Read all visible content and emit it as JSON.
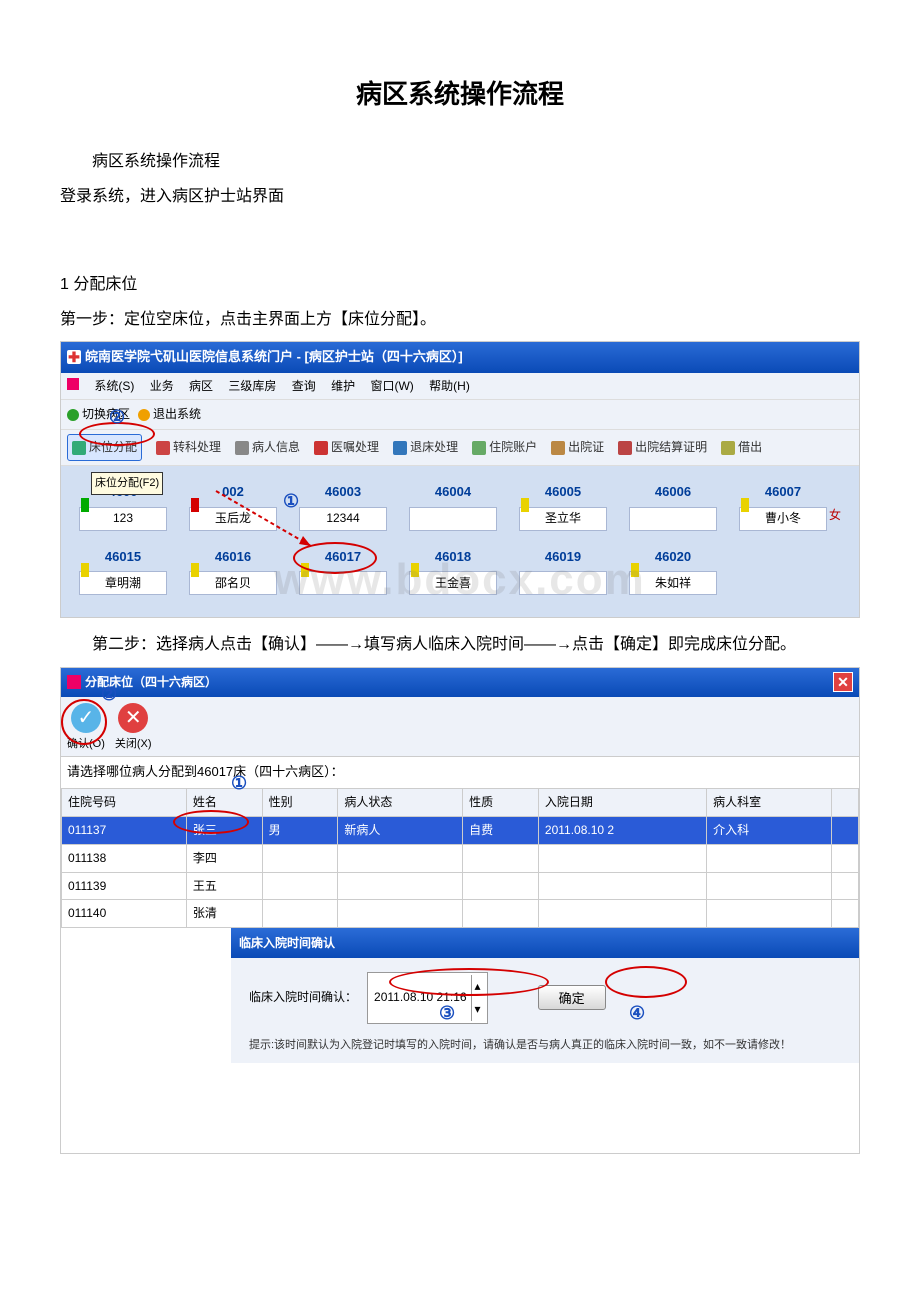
{
  "doc": {
    "title": "病区系统操作流程",
    "p1": "病区系统操作流程",
    "p2": "登录系统，进入病区护士站界面",
    "p3": "1 分配床位",
    "p4": "第一步：定位空床位，点击主界面上方【床位分配】。",
    "p5": "第二步：选择病人点击【确认】——→填写病人临床入院时间——→点击【确定】即完成床位分配。"
  },
  "s1": {
    "title": "皖南医学院弋矶山医院信息系统门户 - [病区护士站（四十六病区）]",
    "menu": {
      "sys": "系统(S)",
      "biz": "业务",
      "ward": "病区",
      "stock": "三级库房",
      "query": "查询",
      "maint": "维护",
      "win": "窗口(W)",
      "help": "帮助(H)"
    },
    "tool1": {
      "switch": "切换病区",
      "exit": "退出系统"
    },
    "tool2": {
      "bed": "床位分配",
      "trans": "转科处理",
      "info": "病人信息",
      "order": "医嘱处理",
      "leave": "退床处理",
      "acct": "住院账户",
      "cert": "出院证",
      "billcert": "出院结算证明",
      "borrow": "借出"
    },
    "tooltip": "床位分配(F2)",
    "beds_r1": [
      {
        "num": "4600",
        "name": "123",
        "tag": "green"
      },
      {
        "num": "002",
        "name": "玉后龙",
        "tag": "red"
      },
      {
        "num": "46003",
        "name": "12344",
        "tag": ""
      },
      {
        "num": "46004",
        "name": "",
        "tag": ""
      },
      {
        "num": "46005",
        "name": "圣立华",
        "tag": "yellow"
      },
      {
        "num": "46006",
        "name": "",
        "tag": ""
      },
      {
        "num": "46007",
        "name": "曹小冬",
        "gender": "女",
        "tag": "yellow"
      }
    ],
    "beds_r2": [
      {
        "num": "46015",
        "name": "章明潮",
        "tag": "yellow"
      },
      {
        "num": "46016",
        "name": "邵名贝",
        "tag": "yellow"
      },
      {
        "num": "46017",
        "name": "",
        "tag": "yellow"
      },
      {
        "num": "46018",
        "name": "王金喜",
        "tag": "yellow"
      },
      {
        "num": "46019",
        "name": "",
        "tag": ""
      },
      {
        "num": "46020",
        "name": "朱如祥",
        "tag": "yellow"
      }
    ]
  },
  "s2": {
    "title": "分配床位（四十六病区）",
    "ok": "确认(O)",
    "close": "关闭(X)",
    "prompt": "请选择哪位病人分配到46017床（四十六病区）：",
    "cols": {
      "id": "住院号码",
      "name": "姓名",
      "sex": "性别",
      "state": "病人状态",
      "type": "性质",
      "date": "入院日期",
      "dept": "病人科室"
    },
    "rows": [
      {
        "id": "011137",
        "name": "张三",
        "sex": "男",
        "state": "新病人",
        "type": "自费",
        "date": "2011.08.10 2",
        "dept": "介入科"
      },
      {
        "id": "011138",
        "name": "李四"
      },
      {
        "id": "011139",
        "name": "王五"
      },
      {
        "id": "011140",
        "name": "张清"
      }
    ],
    "dlg": {
      "title": "临床入院时间确认",
      "label": "临床入院时间确认：",
      "value": "2011.08.10 21:16",
      "ok": "确定",
      "tip": "提示:该时间默认为入院登记时填写的入院时间，请确认是否与病人真正的临床入院时间一致，如不一致请修改！"
    }
  },
  "annot": {
    "c1": "①",
    "c2": "②",
    "c3": "③",
    "c4": "④"
  },
  "watermark": "www.bdocx.com"
}
